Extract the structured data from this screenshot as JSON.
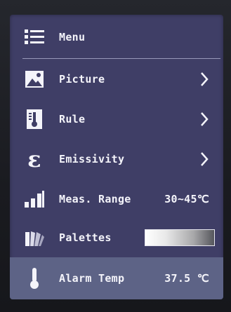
{
  "header": {
    "label": "Menu",
    "icon": "list-menu-icon"
  },
  "items": [
    {
      "label": "Picture",
      "icon": "image-icon",
      "has_submenu": true
    },
    {
      "label": "Rule",
      "icon": "thermometer-ruler-icon",
      "has_submenu": true
    },
    {
      "label": "Emissivity",
      "icon": "epsilon-icon",
      "has_submenu": true
    },
    {
      "label": "Meas. Range",
      "icon": "bar-levels-icon",
      "value": "30~45℃"
    },
    {
      "label": "Palettes",
      "icon": "palette-fan-icon",
      "palette": "white-to-black gradient"
    },
    {
      "label": "Alarm Temp",
      "icon": "thermometer-icon",
      "value": "37.5 ℃",
      "selected": true
    }
  ],
  "colors": {
    "screen_bg": "#3f3e66",
    "selected_row": "#5d6386",
    "text": "#f4f4fa"
  }
}
